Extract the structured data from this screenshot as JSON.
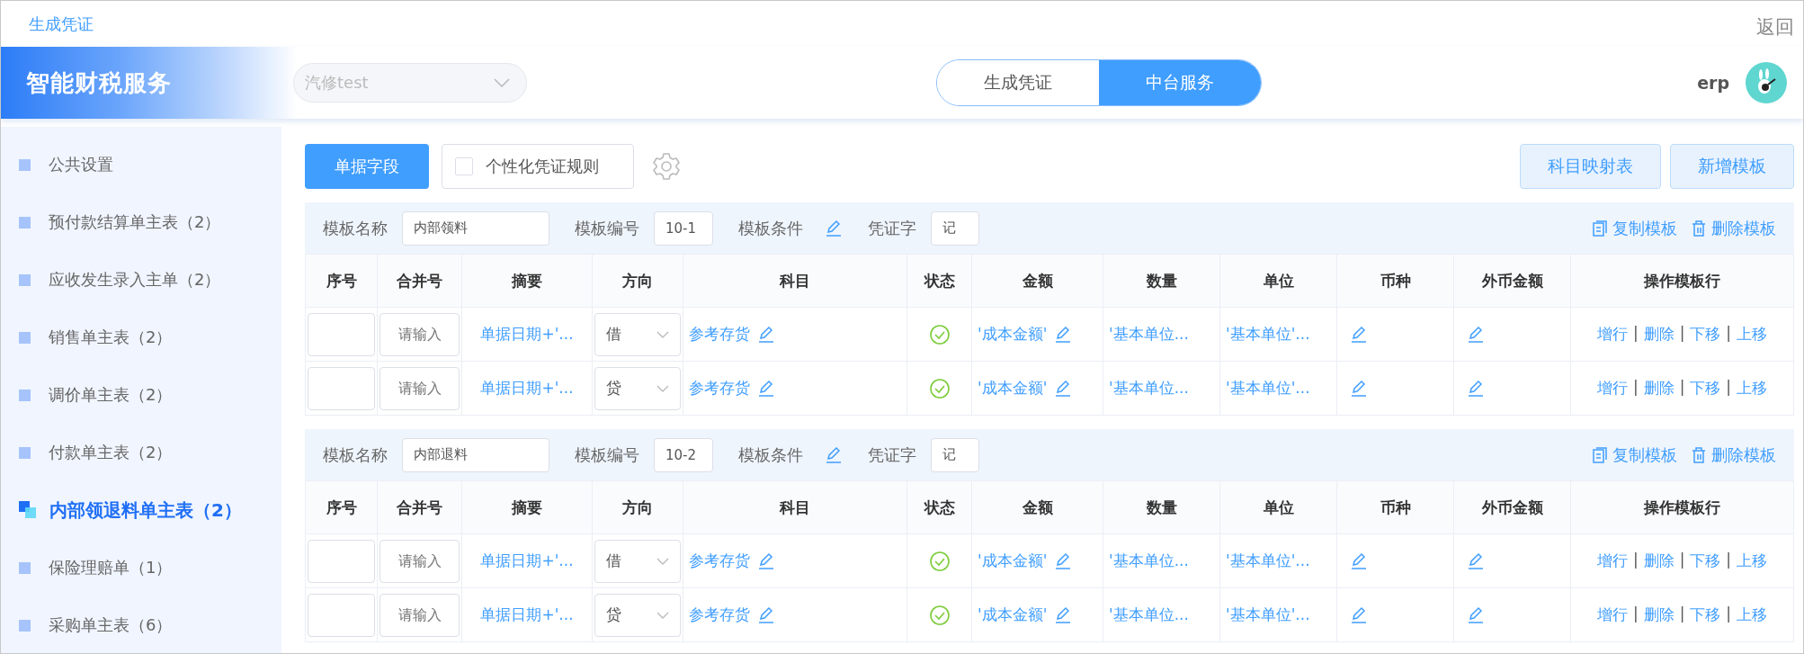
{
  "top_bar": {
    "title": "生成凭证",
    "back": "返回"
  },
  "header": {
    "logo": "智能财税服务",
    "company_select": {
      "value": "汽修test"
    },
    "mode_tabs": [
      {
        "label": "生成凭证",
        "selected": false
      },
      {
        "label": "中台服务",
        "selected": true
      }
    ],
    "user": "erp"
  },
  "sidebar": {
    "items": [
      {
        "label": "公共设置",
        "selected": false
      },
      {
        "label": "预付款结算单主表（2）",
        "selected": false
      },
      {
        "label": "应收发生录入主单（2）",
        "selected": false
      },
      {
        "label": "销售单主表（2）",
        "selected": false
      },
      {
        "label": "调价单主表（2）",
        "selected": false
      },
      {
        "label": "付款单主表（2）",
        "selected": false
      },
      {
        "label": "内部领退料单主表（2）",
        "selected": true
      },
      {
        "label": "保险理赔单（1）",
        "selected": false
      },
      {
        "label": "采购单主表（6）",
        "selected": false
      }
    ]
  },
  "toolbar": {
    "primary_button": "单据字段",
    "personal_rule": {
      "label": "个性化凭证规则",
      "checked": false
    },
    "right_buttons": [
      "科目映射表",
      "新增模板"
    ]
  },
  "templates": [
    {
      "name_label": "模板名称",
      "name": "内部领料",
      "code_label": "模板编号",
      "code": "10-1",
      "condition_label": "模板条件",
      "voucher_label": "凭证字",
      "voucher": "记",
      "copy": "复制模板",
      "delete": "删除模板",
      "columns": [
        "序号",
        "合并号",
        "摘要",
        "方向",
        "科目",
        "状态",
        "金额",
        "数量",
        "单位",
        "币种",
        "外币金额",
        "操作模板行"
      ],
      "rows": [
        {
          "merge_placeholder": "请输入",
          "summary": "单据日期+'...",
          "direction": "借",
          "subject": "参考存货",
          "status_ok": true,
          "amount": "'成本金额'",
          "quantity": "'基本单位...",
          "unit": "'基本单位'...",
          "actions": [
            {
              "kind": "link",
              "label": "增行"
            },
            {
              "kind": "separator",
              "label": "|"
            },
            {
              "kind": "link",
              "label": "删除"
            },
            {
              "kind": "separator",
              "label": "|"
            },
            {
              "kind": "link",
              "label": "下移"
            },
            {
              "kind": "separator",
              "label": "|"
            },
            {
              "kind": "link",
              "label": "上移"
            }
          ]
        },
        {
          "merge_placeholder": "请输入",
          "summary": "单据日期+'...",
          "direction": "贷",
          "subject": "参考存货",
          "status_ok": true,
          "amount": "'成本金额'",
          "quantity": "'基本单位...",
          "unit": "'基本单位'...",
          "actions": [
            {
              "kind": "link",
              "label": "增行"
            },
            {
              "kind": "separator",
              "label": "|"
            },
            {
              "kind": "link",
              "label": "删除"
            },
            {
              "kind": "separator",
              "label": "|"
            },
            {
              "kind": "link",
              "label": "下移"
            },
            {
              "kind": "separator",
              "label": "|"
            },
            {
              "kind": "link",
              "label": "上移"
            }
          ]
        }
      ]
    },
    {
      "name_label": "模板名称",
      "name": "内部退料",
      "code_label": "模板编号",
      "code": "10-2",
      "condition_label": "模板条件",
      "voucher_label": "凭证字",
      "voucher": "记",
      "copy": "复制模板",
      "delete": "删除模板",
      "columns": [
        "序号",
        "合并号",
        "摘要",
        "方向",
        "科目",
        "状态",
        "金额",
        "数量",
        "单位",
        "币种",
        "外币金额",
        "操作模板行"
      ],
      "rows": [
        {
          "merge_placeholder": "请输入",
          "summary": "单据日期+'...",
          "direction": "借",
          "subject": "参考存货",
          "status_ok": true,
          "amount": "'成本金额'",
          "quantity": "'基本单位...",
          "unit": "'基本单位'...",
          "actions": [
            {
              "kind": "link",
              "label": "增行"
            },
            {
              "kind": "separator",
              "label": "|"
            },
            {
              "kind": "link",
              "label": "删除"
            },
            {
              "kind": "separator",
              "label": "|"
            },
            {
              "kind": "link",
              "label": "下移"
            },
            {
              "kind": "separator",
              "label": "|"
            },
            {
              "kind": "link",
              "label": "上移"
            }
          ]
        },
        {
          "merge_placeholder": "请输入",
          "summary": "单据日期+'...",
          "direction": "贷",
          "subject": "参考存货",
          "status_ok": true,
          "amount": "'成本金额'",
          "quantity": "'基本单位...",
          "unit": "'基本单位'...",
          "actions": [
            {
              "kind": "link",
              "label": "增行"
            },
            {
              "kind": "separator",
              "label": "|"
            },
            {
              "kind": "link",
              "label": "删除"
            },
            {
              "kind": "separator",
              "label": "|"
            },
            {
              "kind": "link",
              "label": "下移"
            },
            {
              "kind": "separator",
              "label": "|"
            },
            {
              "kind": "link",
              "label": "上移"
            }
          ]
        }
      ]
    }
  ]
}
